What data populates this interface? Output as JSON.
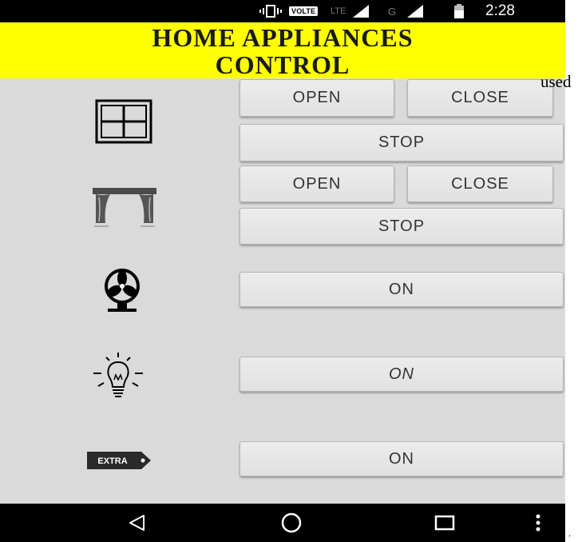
{
  "status_bar": {
    "carrier_badge": "VOLTE",
    "network_lte": "LTE",
    "network_g": "G",
    "time": "2:28",
    "icons": [
      "vibrate-icon",
      "signal-icon",
      "battery-icon"
    ]
  },
  "header": {
    "title": "HOME APPLIANCES\nCONTROL",
    "background": "#ffff00"
  },
  "rows": {
    "window": {
      "icon": "window-icon",
      "open_label": "OPEN",
      "close_label": "CLOSE",
      "stop_label": "STOP"
    },
    "curtain": {
      "icon": "curtain-icon",
      "open_label": "OPEN",
      "close_label": "CLOSE",
      "stop_label": "STOP"
    },
    "fan": {
      "icon": "fan-icon",
      "on_label": "ON"
    },
    "light": {
      "icon": "lightbulb-icon",
      "on_label": "ON"
    },
    "extra": {
      "icon": "extra-tag-icon",
      "tag_text": "EXTRA",
      "on_label": "ON"
    }
  },
  "nav_bar": {
    "icons": [
      "back-icon",
      "home-icon",
      "recents-icon",
      "more-icon"
    ]
  },
  "page_text": {
    "side_word": "used",
    "trailing": "."
  }
}
